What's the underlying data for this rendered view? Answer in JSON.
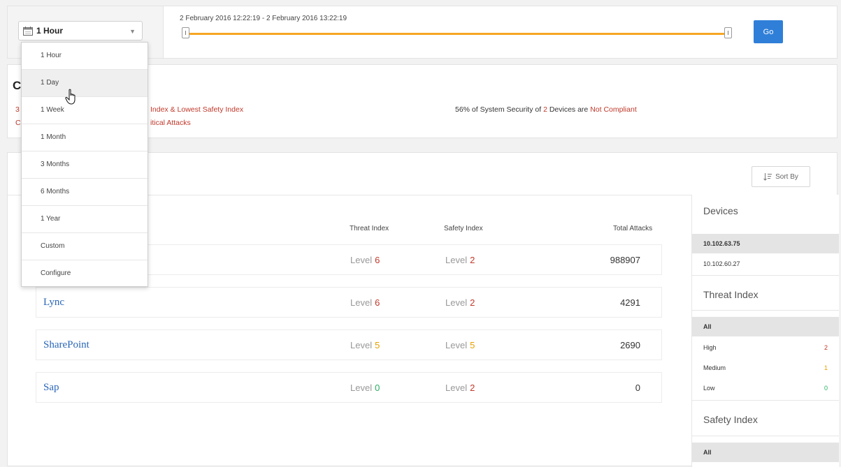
{
  "toolbar": {
    "range_selected": "1 Hour",
    "range_text": "2 February 2016 12:22:19 - 2 February 2016 13:22:19",
    "go_label": "Go"
  },
  "range_menu": {
    "items": [
      "1 Hour",
      "1 Day",
      "1 Week",
      "1 Month",
      "3 Months",
      "6 Months",
      "1 Year",
      "Custom",
      "Configure"
    ],
    "hovered": "1 Day"
  },
  "summary": {
    "title_fragment": "C",
    "line1_mark": "3",
    "line1_text": "Index & Lowest Safety Index",
    "line2_mark": "C",
    "line2_text": "itical Attacks",
    "compliance_prefix": "56% of System Security of",
    "compliance_count": "2",
    "compliance_mid": "Devices are",
    "compliance_status": "Not Compliant"
  },
  "main": {
    "sort_label": "Sort By",
    "columns": {
      "threat": "Threat Index",
      "safety": "Safety Index",
      "attacks": "Total Attacks"
    },
    "level_word": "Level",
    "rows": [
      {
        "name": "",
        "threat_level": "6",
        "safety_level": "2",
        "attacks": "988907"
      },
      {
        "name": "Lync",
        "threat_level": "6",
        "safety_level": "2",
        "attacks": "4291"
      },
      {
        "name": "SharePoint",
        "threat_level": "5",
        "safety_level": "5",
        "attacks": "2690"
      },
      {
        "name": "Sap",
        "threat_level": "0",
        "safety_level": "2",
        "attacks": "0"
      }
    ]
  },
  "filters": {
    "devices_title": "Devices",
    "devices": [
      "10.102.63.75",
      "10.102.60.27"
    ],
    "threat_title": "Threat Index",
    "threat_items": [
      {
        "label": "All",
        "count": ""
      },
      {
        "label": "High",
        "count": "2"
      },
      {
        "label": "Medium",
        "count": "1"
      },
      {
        "label": "Low",
        "count": "0"
      }
    ],
    "safety_title": "Safety Index",
    "safety_items": [
      {
        "label": "All",
        "count": ""
      }
    ]
  },
  "colors": {
    "accent": "#2f7fd8",
    "slider": "#f5a623",
    "alert": "#c0392b",
    "warn": "#e6a000",
    "ok": "#27ae60",
    "link": "#2a66b8"
  },
  "icons": {
    "range_select": "calendar-icon",
    "sort": "sort-icon",
    "cursor": "hand-pointer-icon"
  }
}
